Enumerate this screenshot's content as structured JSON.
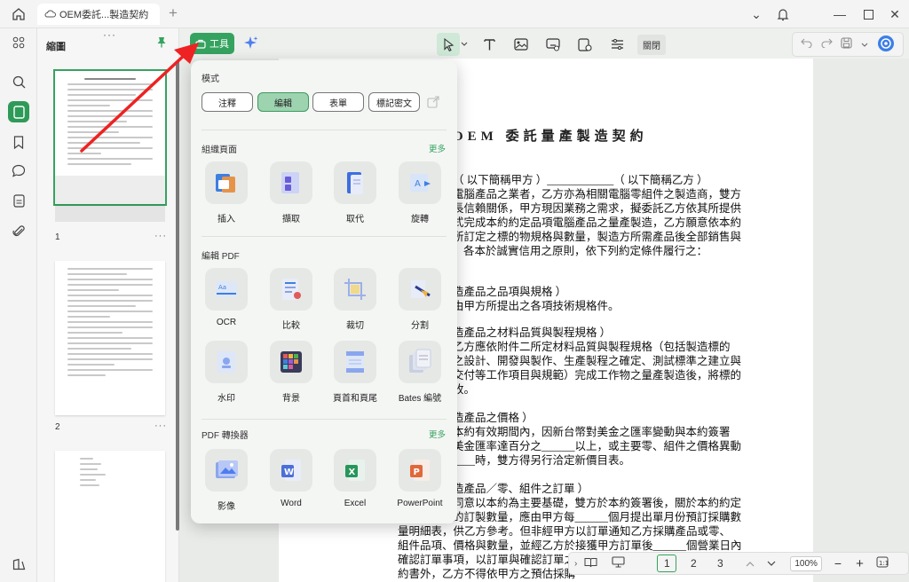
{
  "titlebar": {
    "tab_title": "OEM委託...製造契約"
  },
  "thumbnails": {
    "title": "縮圖",
    "pages": [
      "1",
      "2"
    ],
    "more": "···"
  },
  "toolbar": {
    "tools_label": "工具",
    "close_label": "關閉"
  },
  "popup": {
    "modes_title": "模式",
    "modes": [
      "注釋",
      "編輯",
      "表單",
      "標記密文"
    ],
    "selected_mode": "編輯",
    "section1": {
      "title": "組織頁面",
      "more": "更多",
      "items": [
        "插入",
        "擷取",
        "取代",
        "旋轉"
      ]
    },
    "section2": {
      "title": "編輯 PDF",
      "items": [
        "OCR",
        "比較",
        "裁切",
        "分割",
        "水印",
        "背景",
        "頁首和頁尾",
        "Bates 編號"
      ]
    },
    "section3": {
      "title": "PDF 轉換器",
      "more": "更多",
      "items": [
        "影像",
        "Word",
        "Excel",
        "PowerPoint"
      ]
    }
  },
  "document": {
    "title": "OEM 委託量產製造契約",
    "lines": [
      "（ 以下簡稱甲方 ）____________（ 以下簡稱乙方 ）",
      "電腦產品之業者，乙方亦為相關電腦零組件之製造商，雙方",
      "長信賴關係，甲方現因業務之需求，擬委託乙方依其所提供",
      "式完成本約約定品項電腦產品之量產製造，乙方願意依本約",
      "所訂定之標的物規格與數量，製造方所需產品後全部銷售與",
      "各本於誠實信用之原則，依下列約定條件履行之：",
      "造產品之品項與規格 ）",
      "由甲方所提出之各項技術規格件。",
      "造產品之材料品質與製程規格 ）",
      "乙方應依附件二所定材料品質與製程規格（包括製造標的",
      "之設計、開發與製作、生產製程之確定、測試標準之建立與",
      "交付等工作項目與規範）完成工作物之量產製造後，將標的",
      "收。",
      "造產品之價格 ）",
      "本約有效期間內，因新台幣對美金之匯率變動與本約簽署",
      "美金匯率達百分之______以上，或主要零、組件之價格異動",
      "____時，雙方得另行洽定新價目表。",
      "造產品／零、組件之訂單 ）",
      "同意以本約為主要基礎，雙方於本約簽署後，關於本約約定",
      "的訂製數量，應由甲方每______個月提出單月份預訂採購數",
      "量明細表，供乙方參考。但非經甲方以訂單通知乙方採購產品或零、",
      "組件品項、價格與數量，並經乙方於接獲甲方訂單後______個營業日內",
      "確認訂單事項，以訂單與確認訂單之",
      "約書外，乙方不得依甲方之預估採購"
    ]
  },
  "bottom": {
    "pages": [
      "1",
      "2",
      "3"
    ],
    "current_page": "1",
    "zoom": "100%"
  }
}
